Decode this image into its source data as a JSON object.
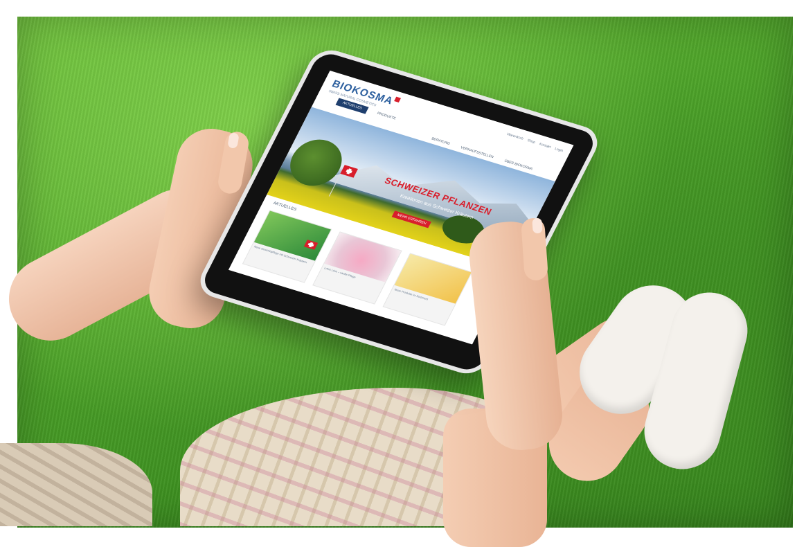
{
  "website": {
    "logo_text": "BIOKOSMA",
    "logo_tagline": "SWISS NATURAL COSMETICS",
    "utility_links": [
      "Warenkorb",
      "Shop",
      "Kontakt",
      "Login"
    ],
    "nav_tabs": [
      "AKTUELLES",
      "PRODUKTE"
    ],
    "sub_nav": [
      "BERATUNG",
      "VERKAUFSSTELLEN",
      "ÜBER BIOKOSMA"
    ],
    "hero_title": "SCHWEIZER PFLANZEN",
    "hero_subtitle": "Kreationen aus Schweizer Kräutern",
    "hero_button": "MEHR ERFAHREN",
    "section_title": "AKTUELLES",
    "cards": [
      {
        "caption": "Neue Gesichtspflege mit Schweizer Kräutern"
      },
      {
        "caption": "Lotus Linie – sanfte Pflege"
      },
      {
        "caption": "Neue Produkte im Sortiment"
      }
    ]
  },
  "colors": {
    "brand_blue": "#2c5f9e",
    "swiss_red": "#d81e2b",
    "grass_green": "#4ea42a"
  }
}
